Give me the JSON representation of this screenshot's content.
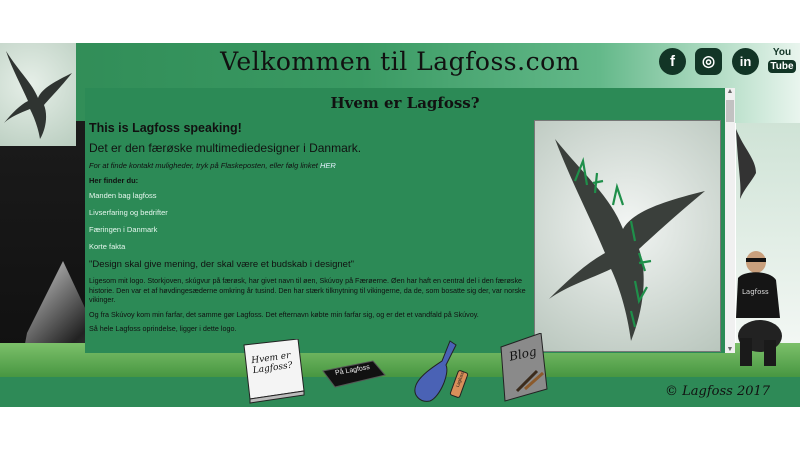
{
  "site": {
    "title": "Velkommen til Lagfoss.com",
    "copyright": "© Lagfoss 2017"
  },
  "social": {
    "facebook": "f",
    "instagram": "◎",
    "linkedin": "in",
    "youtube_top": "You",
    "youtube_bottom": "Tube"
  },
  "panel": {
    "title": "Hvem er Lagfoss?",
    "heading": "This is Lagfoss speaking!",
    "subheading": "Det er den færøske multimediedesigner i Danmark.",
    "contact_note": "For at finde kontakt muligheder, tryk på Flaskeposten, eller følg linket",
    "contact_link": "HER",
    "links_heading": "Her finder du:",
    "links": [
      "Manden bag lagfoss",
      "Livserfaring og bedrifter",
      "Færingen i Danmark",
      "Korte fakta"
    ],
    "quote": "\"Design skal give mening, der skal være et budskab i designet\"",
    "paragraphs": [
      "Ligesom mit logo. Storkjoven, skúgvur på færøsk, har givet navn til øen, Skúvoy på Færøerne. Øen har haft en central del i den færøske historie. Den var et af høvdingesæderne omkring år tusind. Den har stærk tilknytning til vikingerne, da de, som bosatte sig der, var norske vikinger.",
      "Og fra Skúvoy kom min farfar, det samme gør Lagfoss. Det efternavn købte min farfar sig, og er det et vandfald på Skúvoy.",
      "Så hele Lagfoss oprindelse, ligger i dette logo."
    ]
  },
  "nav_icons": {
    "book_label": "Hvem er Lagfoss?",
    "dark_book_label": "På Lagfoss",
    "bottle_label": "Lagfoss",
    "blog_label": "Blog"
  },
  "colors": {
    "panel": "#2c8a56",
    "footer": "#2e8a57",
    "social": "#123526"
  }
}
